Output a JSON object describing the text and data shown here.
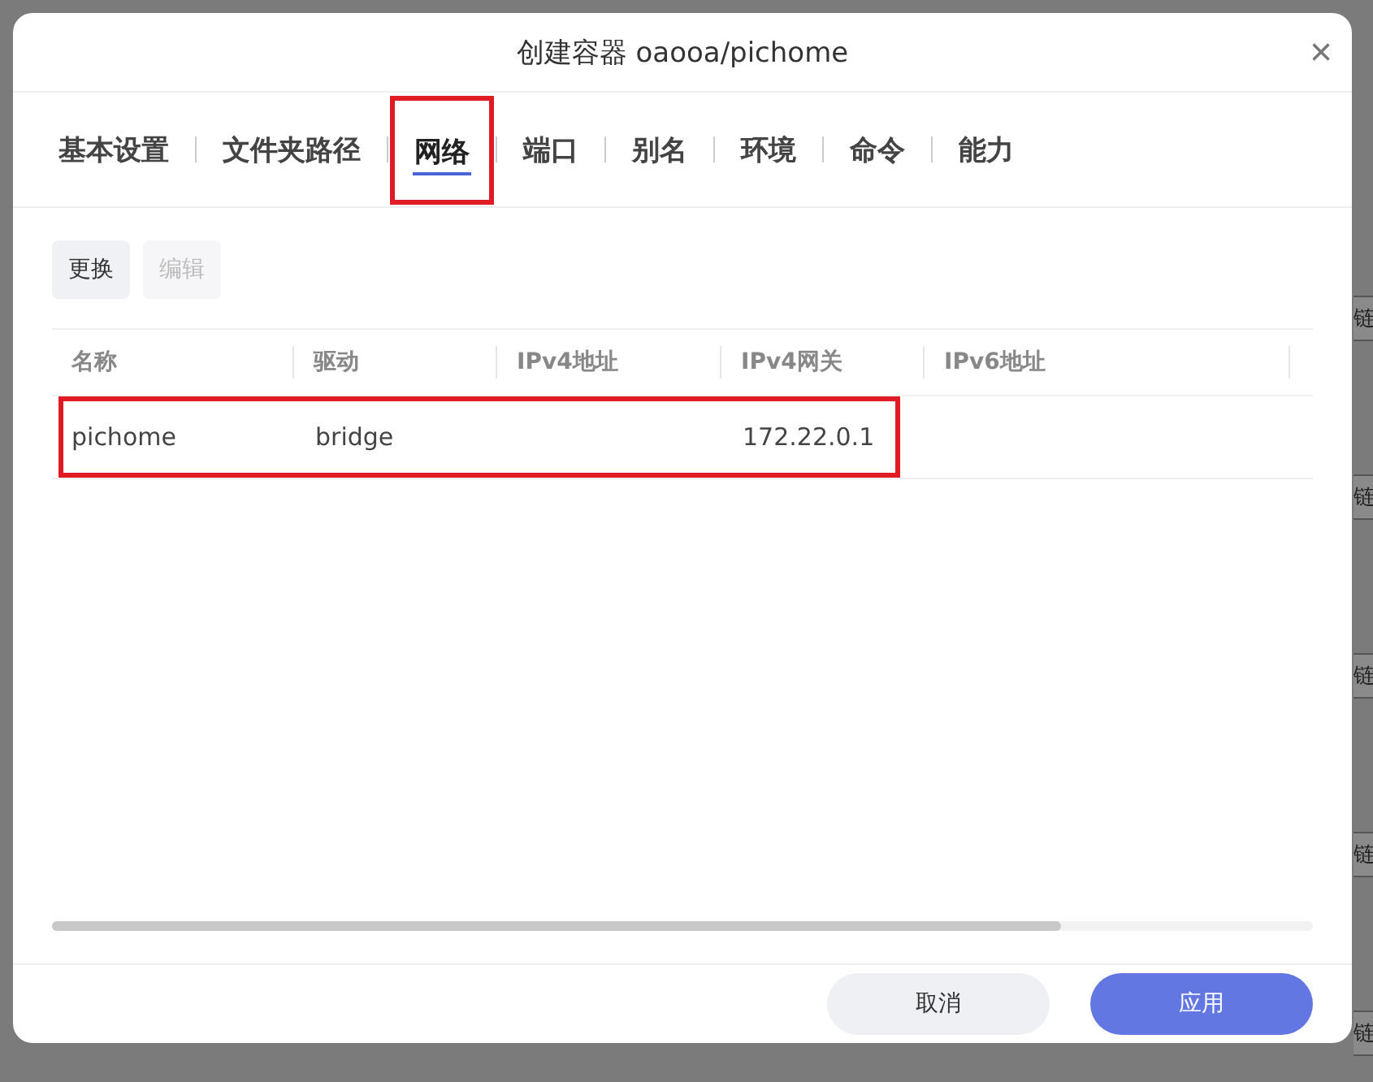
{
  "background": {
    "side_texts": [
      "链",
      "链",
      "链",
      "链",
      "链"
    ]
  },
  "dialog": {
    "title": "创建容器 oaooa/pichome",
    "close": "×"
  },
  "tabs": [
    {
      "label": "基本设置",
      "selected": false,
      "highlighted": false
    },
    {
      "label": "文件夹路径",
      "selected": false,
      "highlighted": false
    },
    {
      "label": "网络",
      "selected": true,
      "highlighted": true
    },
    {
      "label": "端口",
      "selected": false,
      "highlighted": false
    },
    {
      "label": "别名",
      "selected": false,
      "highlighted": false
    },
    {
      "label": "环境",
      "selected": false,
      "highlighted": false
    },
    {
      "label": "命令",
      "selected": false,
      "highlighted": false
    },
    {
      "label": "能力",
      "selected": false,
      "highlighted": false
    }
  ],
  "toolbar": [
    {
      "label": "更换",
      "disabled": false
    },
    {
      "label": "编辑",
      "disabled": true
    }
  ],
  "table": {
    "columns": [
      "名称",
      "驱动",
      "IPv4地址",
      "IPv4网关",
      "IPv6地址"
    ],
    "rows": [
      {
        "cells": [
          "pichome",
          "bridge",
          "",
          "172.22.0.1",
          ""
        ],
        "highlighted": true
      }
    ]
  },
  "footer": {
    "buttons": [
      {
        "label": "取消",
        "kind": "secondary"
      },
      {
        "label": "应用",
        "kind": "primary"
      }
    ]
  }
}
